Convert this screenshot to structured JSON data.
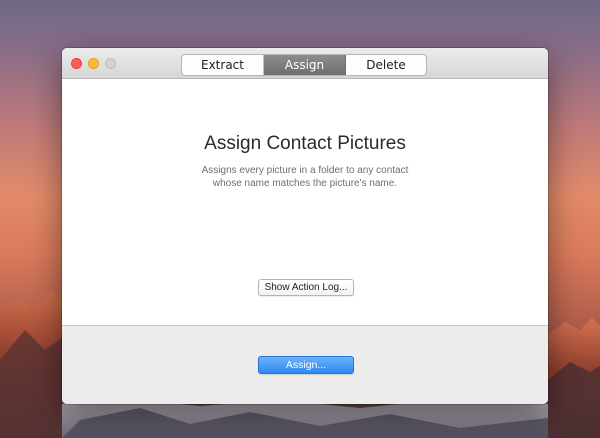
{
  "toolbar": {
    "tabs": [
      {
        "label": "Extract",
        "active": false
      },
      {
        "label": "Assign",
        "active": true
      },
      {
        "label": "Delete",
        "active": false
      }
    ]
  },
  "main": {
    "title": "Assign Contact Pictures",
    "description_line1": "Assigns every picture in a folder to any contact",
    "description_line2": "whose name matches the picture's name.",
    "log_button_label": "Show Action Log..."
  },
  "footer": {
    "primary_button_label": "Assign..."
  },
  "colors": {
    "accent": "#2f88f1",
    "active_tab": "#7a7a7a",
    "close": "#fc5f57",
    "minimize": "#fdbc2e",
    "zoom_disabled": "#d2d2d2"
  },
  "icons": {
    "close": "close-icon",
    "minimize": "minimize-icon",
    "zoom": "zoom-icon"
  }
}
